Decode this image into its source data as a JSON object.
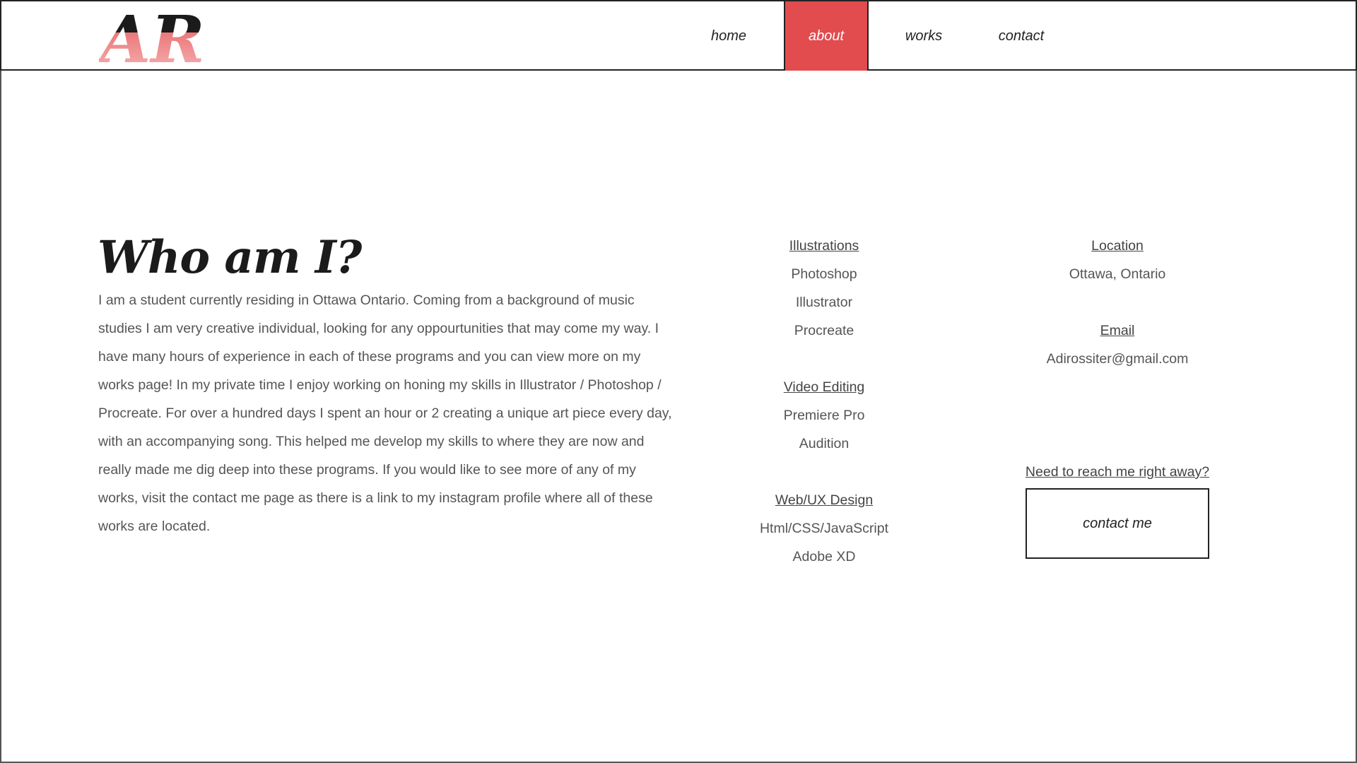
{
  "logo": {
    "text": "AR",
    "colors": {
      "top": "#1b1b1b",
      "accent": "#e24c4f"
    }
  },
  "nav": {
    "items": [
      {
        "label": "home",
        "active": false
      },
      {
        "label": "about",
        "active": true
      },
      {
        "label": "works",
        "active": false
      },
      {
        "label": "contact",
        "active": false
      }
    ],
    "active_color": "#e24c4f"
  },
  "about": {
    "title": "Who am I?",
    "bio": "I am a student currently residing in Ottawa Ontario. Coming from a background of music studies I am very creative individual, looking for any oppourtunities that may come my way. I have many hours of experience in each of these programs and you can view more on my works page! In my private time I enjoy working on honing my skills in Illustrator / Photoshop / Procreate. For over a hundred days I spent an hour or 2 creating a unique art piece every day, with an accompanying song. This helped me develop my skills to where they are now and really made me dig deep into these programs. If you would like to see more of any of my works, visit the contact me page as there is a link to my instagram profile where all of these works are located."
  },
  "skills": [
    {
      "heading": "Illustrations",
      "items": [
        "Photoshop",
        "Illustrator",
        "Procreate"
      ]
    },
    {
      "heading": "Video Editing",
      "items": [
        "Premiere Pro",
        "Audition"
      ]
    },
    {
      "heading": "Web/UX Design",
      "items": [
        "Html/CSS/JavaScript",
        "Adobe XD"
      ]
    }
  ],
  "contact": {
    "location_heading": "Location",
    "location_value": "Ottawa, Ontario",
    "email_heading": "Email",
    "email_value": "Adirossiter@gmail.com",
    "reach_prompt": "Need to reach me right away?",
    "button_label": "contact me"
  }
}
